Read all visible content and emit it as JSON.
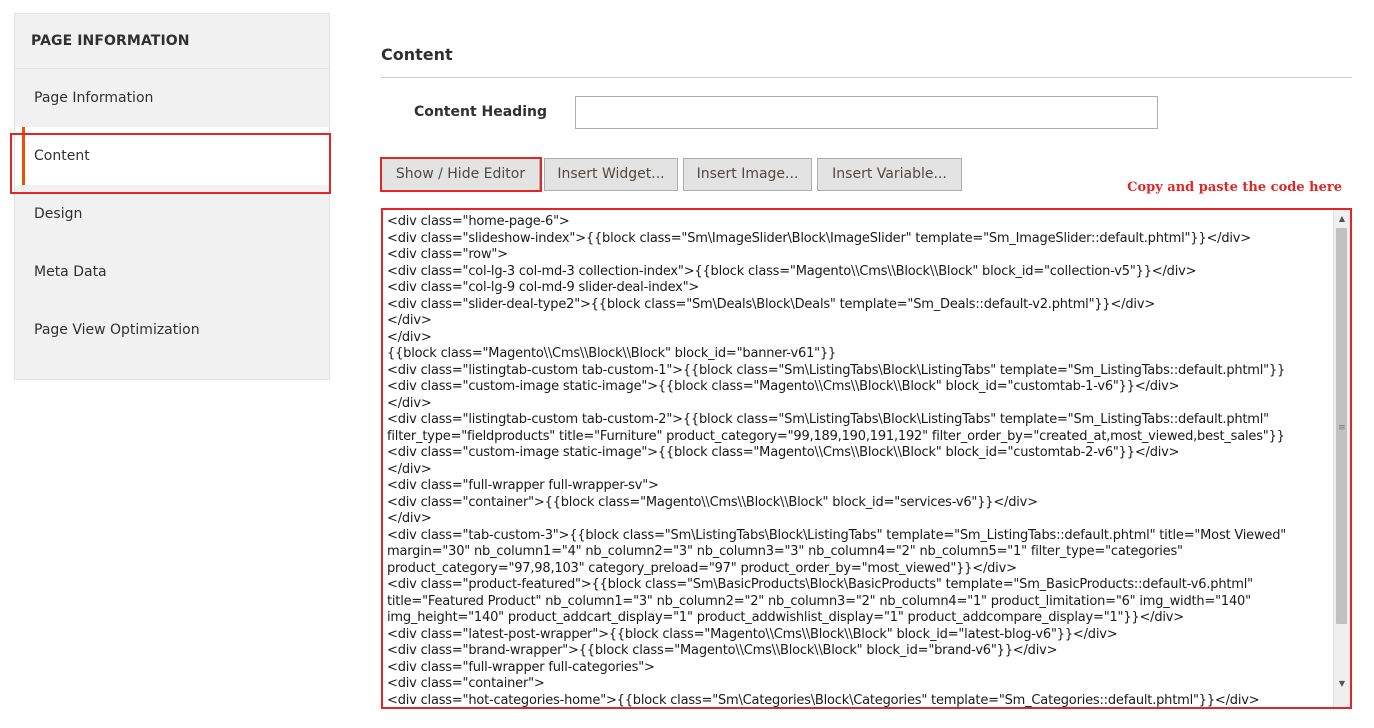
{
  "sidebar": {
    "title": "PAGE INFORMATION",
    "items": [
      {
        "label": "Page Information"
      },
      {
        "label": "Content"
      },
      {
        "label": "Design"
      },
      {
        "label": "Meta Data"
      },
      {
        "label": "Page View Optimization"
      }
    ],
    "active": "Content"
  },
  "main": {
    "section_title": "Content",
    "content_heading": {
      "label": "Content Heading",
      "value": ""
    },
    "buttons": {
      "show_hide_editor": "Show / Hide Editor",
      "insert_widget": "Insert Widget...",
      "insert_image": "Insert Image...",
      "insert_variable": "Insert Variable..."
    },
    "annotation": "Copy and paste the code here",
    "editor_lines": [
      "<div class=\"home-page-6\">",
      "<div class=\"slideshow-index\">{{block class=\"Sm\\ImageSlider\\Block\\ImageSlider\" template=\"Sm_ImageSlider::default.phtml\"}}</div>",
      "<div class=\"row\">",
      "<div class=\"col-lg-3 col-md-3 collection-index\">{{block class=\"Magento\\\\Cms\\\\Block\\\\Block\" block_id=\"collection-v5\"}}</div>",
      "<div class=\"col-lg-9 col-md-9 slider-deal-index\">",
      "<div class=\"slider-deal-type2\">{{block class=\"Sm\\Deals\\Block\\Deals\" template=\"Sm_Deals::default-v2.phtml\"}}</div>",
      "</div>",
      "</div>",
      "{{block class=\"Magento\\\\Cms\\\\Block\\\\Block\" block_id=\"banner-v61\"}}",
      "<div class=\"listingtab-custom tab-custom-1\">{{block class=\"Sm\\ListingTabs\\Block\\ListingTabs\" template=\"Sm_ListingTabs::default.phtml\"}}",
      "<div class=\"custom-image static-image\">{{block class=\"Magento\\\\Cms\\\\Block\\\\Block\" block_id=\"customtab-1-v6\"}}</div>",
      "</div>",
      "<div class=\"listingtab-custom tab-custom-2\">{{block class=\"Sm\\ListingTabs\\Block\\ListingTabs\" template=\"Sm_ListingTabs::default.phtml\"",
      "filter_type=\"fieldproducts\" title=\"Furniture\" product_category=\"99,189,190,191,192\" filter_order_by=\"created_at,most_viewed,best_sales\"}}",
      "<div class=\"custom-image static-image\">{{block class=\"Magento\\\\Cms\\\\Block\\\\Block\" block_id=\"customtab-2-v6\"}}</div>",
      "</div>",
      "<div class=\"full-wrapper full-wrapper-sv\">",
      "<div class=\"container\">{{block class=\"Magento\\\\Cms\\\\Block\\\\Block\" block_id=\"services-v6\"}}</div>",
      "</div>",
      "<div class=\"tab-custom-3\">{{block class=\"Sm\\ListingTabs\\Block\\ListingTabs\" template=\"Sm_ListingTabs::default.phtml\" title=\"Most Viewed\"",
      "margin=\"30\" nb_column1=\"4\" nb_column2=\"3\" nb_column3=\"3\" nb_column4=\"2\" nb_column5=\"1\" filter_type=\"categories\"",
      "product_category=\"97,98,103\" category_preload=\"97\" product_order_by=\"most_viewed\"}}</div>",
      "<div class=\"product-featured\">{{block class=\"Sm\\BasicProducts\\Block\\BasicProducts\" template=\"Sm_BasicProducts::default-v6.phtml\"",
      "title=\"Featured Product\" nb_column1=\"3\" nb_column2=\"2\" nb_column3=\"2\" nb_column4=\"1\" product_limitation=\"6\" img_width=\"140\"",
      "img_height=\"140\" product_addcart_display=\"1\" product_addwishlist_display=\"1\" product_addcompare_display=\"1\"}}</div>",
      "<div class=\"latest-post-wrapper\">{{block class=\"Magento\\\\Cms\\\\Block\\\\Block\" block_id=\"latest-blog-v6\"}}</div>",
      "<div class=\"brand-wrapper\">{{block class=\"Magento\\\\Cms\\\\Block\\\\Block\" block_id=\"brand-v6\"}}</div>",
      "<div class=\"full-wrapper full-categories\">",
      "<div class=\"container\">",
      "<div class=\"hot-categories-home\">{{block class=\"Sm\\Categories\\Block\\Categories\" template=\"Sm_Categories::default.phtml\"}}</div>"
    ]
  },
  "colors": {
    "accent": "#eb5202",
    "highlight": "#e22626",
    "sidebar_bg": "#f1f1f1",
    "button_bg": "#e3e3e3"
  }
}
